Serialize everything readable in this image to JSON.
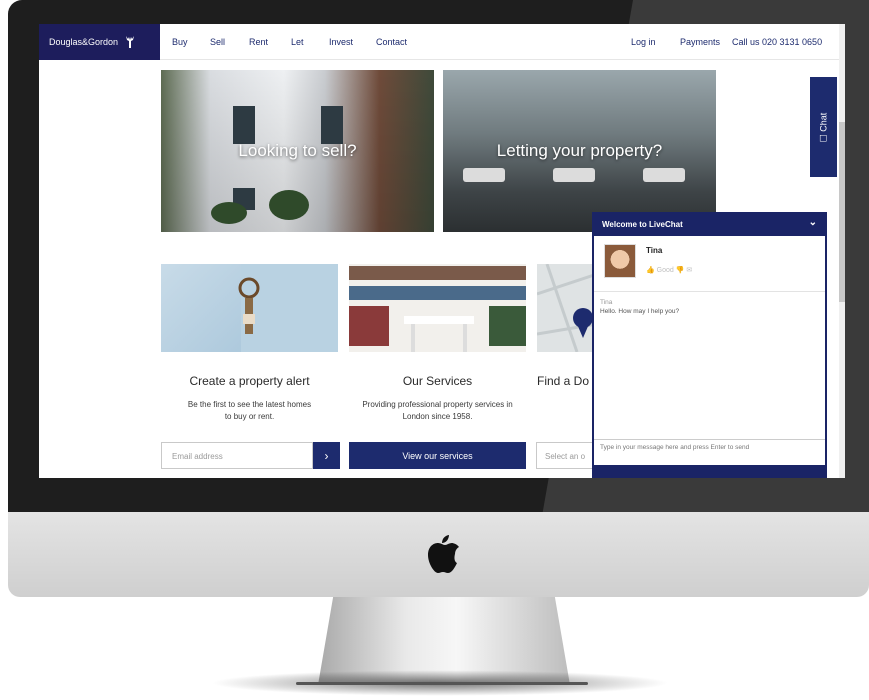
{
  "brand": {
    "name": "Douglas&Gordon"
  },
  "nav": {
    "items": [
      "Buy",
      "Sell",
      "Rent",
      "Let",
      "Invest",
      "Contact"
    ],
    "right": [
      "Log in",
      "Payments",
      "Call us 020 3131 0650"
    ]
  },
  "hero": [
    {
      "label": "Looking to sell?"
    },
    {
      "label": "Letting your property?"
    }
  ],
  "cards": [
    {
      "title": "Create a property alert",
      "text": "Be the first to see the latest homes to buy or rent.",
      "placeholder": "Email address",
      "action": "›"
    },
    {
      "title": "Our Services",
      "text": "Providing professional property services in London since 1958.",
      "action": "View our services"
    },
    {
      "title": "Find a Do",
      "placeholder": "Select an o"
    }
  ],
  "chat_tab": {
    "label": "Chat",
    "icon": "chat-bubble-icon"
  },
  "chat": {
    "header": "Welcome to LiveChat",
    "agent_name": "Tina",
    "rate_label": "Good",
    "message_author": "Tina",
    "message_text": "Hello. How may I help you?",
    "input_placeholder": "Type in your message here and press Enter to send"
  },
  "colors": {
    "brand": "#1d1d5c",
    "accent": "#1d2b6e",
    "chat": "#1a2466"
  },
  "icons": {
    "logo": "stag-icon",
    "hardware": "apple-logo-icon"
  }
}
